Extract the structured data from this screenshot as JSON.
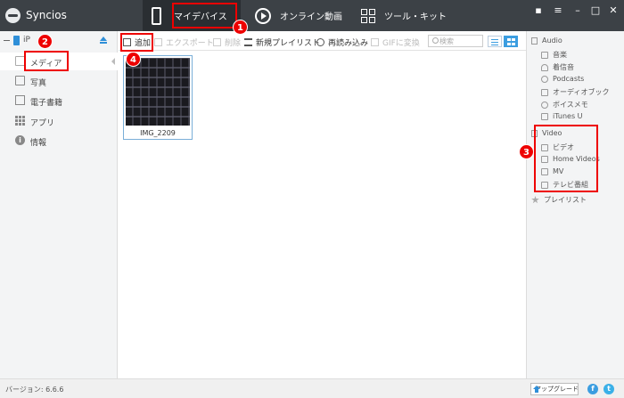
{
  "app": {
    "title": "Syncios"
  },
  "tabs": [
    {
      "label": "マイデバイス"
    },
    {
      "label": "オンライン動画"
    },
    {
      "label": "ツール・キット"
    }
  ],
  "window_controls": {
    "chat": "▪",
    "menu": "≡",
    "minimize": "–",
    "maximize": "□",
    "close": "✕"
  },
  "sidebar": {
    "device_name": "iP",
    "items": [
      {
        "label": "メディア",
        "icon": "media-icon"
      },
      {
        "label": "写真",
        "icon": "photo-icon"
      },
      {
        "label": "電子書籍",
        "icon": "ebook-icon"
      },
      {
        "label": "アプリ",
        "icon": "apps-icon"
      },
      {
        "label": "情報",
        "icon": "info-icon"
      }
    ]
  },
  "toolbar": {
    "add": "追加",
    "export": "エクスポート",
    "delete": "削除",
    "new_playlist": "新規プレイリスト",
    "reload": "再読み込み",
    "gif": "GIFに変換",
    "search_placeholder": "検索"
  },
  "files": [
    {
      "name": "IMG_2209"
    }
  ],
  "right_panel": {
    "audio_header": "Audio",
    "audio_items": [
      "音楽",
      "着信音",
      "Podcasts",
      "オーディオブック",
      "ボイスメモ",
      "iTunes U"
    ],
    "video_header": "Video",
    "video_items": [
      "ビデオ",
      "Home Videos",
      "MV",
      "テレビ番組"
    ],
    "playlist": "プレイリスト"
  },
  "annotations": [
    "1",
    "2",
    "3",
    "4"
  ],
  "status": {
    "version": "バージョン: 6.6.6",
    "upgrade": "アップグレード"
  },
  "social": {
    "facebook": "f",
    "twitter": "t"
  },
  "colors": {
    "titlebar": "#3c4146",
    "accent": "#3b9de0",
    "highlight": "#e00000"
  }
}
